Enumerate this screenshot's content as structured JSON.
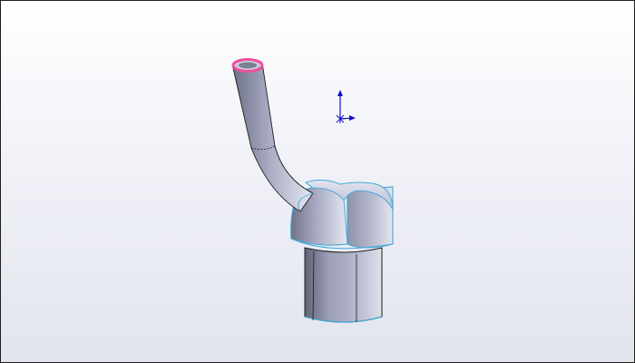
{
  "viewport": {
    "view": "3d-model-viewport",
    "background_colors": {
      "top": "#ffffff",
      "bottom": "#e2e4ee"
    }
  },
  "model": {
    "kind": "pipe-with-bend-and-transition-body",
    "face_color": "#a3a7c0",
    "edge_color": "#1e1e1e",
    "selected_edge_color": "#45a8d8",
    "highlight_color": "#ee4f9c"
  },
  "triad": {
    "icon": "coordinate-triad-icon",
    "axis_color": "#1010c8"
  }
}
